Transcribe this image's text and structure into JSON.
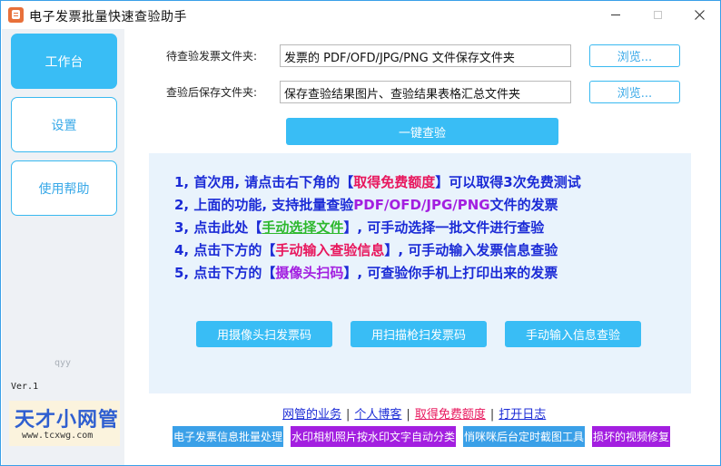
{
  "window": {
    "title": "电子发票批量快速查验助手"
  },
  "sidebar": {
    "items": [
      {
        "label": "工作台",
        "active": true
      },
      {
        "label": "设置",
        "active": false
      },
      {
        "label": "使用帮助",
        "active": false
      }
    ],
    "watermark": "qyy",
    "version": "Ver.1",
    "logo": {
      "main": "天才小网管",
      "sub": "www.tcxwg.com"
    }
  },
  "form": {
    "source_label": "待查验发票文件夹:",
    "source_value": "发票的 PDF/OFD/JPG/PNG 文件保存文件夹",
    "output_label": "查验后保存文件夹:",
    "output_value": "保存查验结果图片、查验结果表格汇总文件夹",
    "browse_label": "浏览...",
    "check_button": "一键查验"
  },
  "tips": {
    "line1": {
      "pre": "1, 首次用, 请点击右下角的【",
      "hl": "取得免费额度",
      "post": "】可以取得3次免费测试"
    },
    "line2": {
      "pre": "2, 上面的功能, 支持批量查验",
      "hl": "PDF/OFD/JPG/PNG",
      "post": "文件的发票"
    },
    "line3": {
      "pre": "3, 点击此处【",
      "hl": "手动选择文件",
      "post": "】, 可手动选择一批文件进行查验"
    },
    "line4": {
      "pre": "4, 点击下方的【",
      "hl": "手动输入查验信息",
      "post": "】, 可手动输入发票信息查验"
    },
    "line5": {
      "pre": "5, 点击下方的【",
      "hl": "摄像头扫码",
      "post": "】, 可查验你手机上打印出来的发票"
    }
  },
  "actions": {
    "camera": "用摄像头扫发票码",
    "scanner": "用扫描枪扫发票码",
    "manual": "手动输入信息查验"
  },
  "links": {
    "business": "网管的业务",
    "blog": "个人博客",
    "free_quota": "取得免费额度",
    "log": "打开日志",
    "separator": "|"
  },
  "ads": {
    "ad1": "电子发票信息批量处理",
    "ad2": "水印相机照片按水印文字自动分类",
    "ad3": "悄咪咪后台定时截图工具",
    "ad4": "损坏的视频修复"
  },
  "colors": {
    "accent": "#39bdf5",
    "tip_text": "#1b2bd6",
    "highlight_red": "#e8175d",
    "highlight_purple": "#a31fe0",
    "highlight_green": "#2eb82e"
  }
}
